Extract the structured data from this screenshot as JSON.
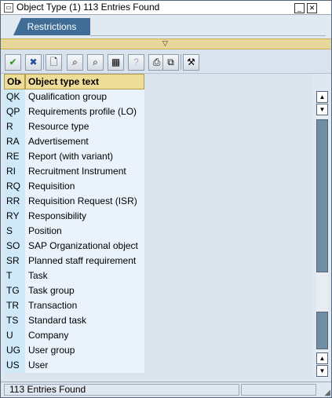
{
  "window": {
    "title": "Object Type (1)  113 Entries Found",
    "minimize_icon": "minimize-icon",
    "close_icon": "close-icon"
  },
  "restrictions": {
    "tab_label": "Restrictions"
  },
  "toolbar": {
    "buttons": [
      {
        "name": "accept-icon",
        "glyph": "✔",
        "enabled": true,
        "color": "#2f8a1f"
      },
      {
        "name": "cancel-icon",
        "glyph": "✖",
        "enabled": true,
        "color": "#2b4fa0"
      },
      {
        "name": "new-document-icon",
        "glyph": "🗋",
        "enabled": true
      },
      {
        "name": "find-icon",
        "glyph": "⌕",
        "enabled": true
      },
      {
        "name": "find-next-icon",
        "glyph": "⌕",
        "enabled": true
      },
      {
        "name": "filter-icon",
        "glyph": "▦",
        "enabled": true
      },
      {
        "name": "help-icon",
        "glyph": "?",
        "enabled": false
      },
      {
        "name": "print-icon",
        "glyph": "⎙",
        "enabled": true
      },
      {
        "name": "copy-icon",
        "glyph": "⧉",
        "enabled": true
      },
      {
        "name": "settings-icon",
        "glyph": "⚒",
        "enabled": true
      }
    ]
  },
  "table": {
    "columns": [
      "Ob",
      "Object type text"
    ],
    "rows": [
      [
        "QK",
        "Qualification group"
      ],
      [
        "QP",
        "Requirements profile (LO)"
      ],
      [
        "R",
        "Resource type"
      ],
      [
        "RA",
        "Advertisement"
      ],
      [
        "RE",
        "Report (with variant)"
      ],
      [
        "RI",
        "Recruitment Instrument"
      ],
      [
        "RQ",
        "Requisition"
      ],
      [
        "RR",
        "Requisition Request (ISR)"
      ],
      [
        "RY",
        "Responsibility"
      ],
      [
        "S",
        "Position"
      ],
      [
        "SO",
        "SAP Organizational object"
      ],
      [
        "SR",
        "Planned staff requirement"
      ],
      [
        "T",
        "Task"
      ],
      [
        "TG",
        "Task group"
      ],
      [
        "TR",
        "Transaction"
      ],
      [
        "TS",
        "Standard task"
      ],
      [
        "U",
        "Company"
      ],
      [
        "UG",
        "User group"
      ],
      [
        "US",
        "User"
      ]
    ]
  },
  "status": {
    "text": "113 Entries Found"
  }
}
